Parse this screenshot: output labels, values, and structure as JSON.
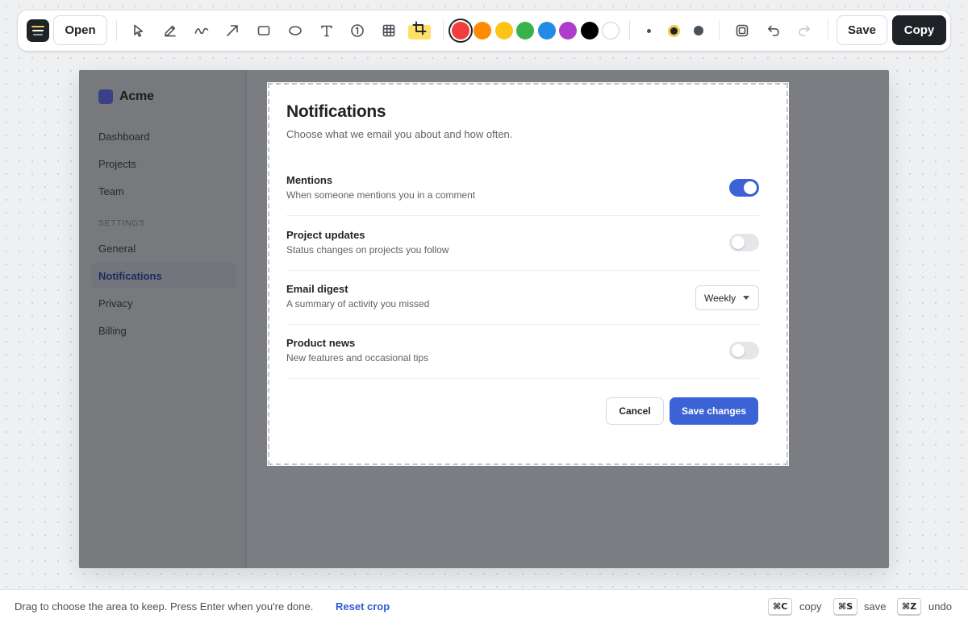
{
  "toolbar": {
    "open_label": "Open",
    "save_label": "Save",
    "copy_label": "Copy",
    "tools": [
      {
        "name": "select",
        "icon": "pointer-icon"
      },
      {
        "name": "pen",
        "icon": "pencil-icon"
      },
      {
        "name": "freehand",
        "icon": "squiggle-icon"
      },
      {
        "name": "arrow",
        "icon": "arrow-icon"
      },
      {
        "name": "rectangle",
        "icon": "rectangle-icon"
      },
      {
        "name": "ellipse",
        "icon": "ellipse-icon"
      },
      {
        "name": "text",
        "icon": "text-icon"
      },
      {
        "name": "counter",
        "icon": "numbered-circle-icon",
        "glyph": "1"
      },
      {
        "name": "grid",
        "icon": "grid-icon"
      },
      {
        "name": "crop",
        "icon": "crop-icon",
        "active": true
      }
    ],
    "colors": [
      "#f03e3e",
      "#fd8c00",
      "#fcc419",
      "#37b24d",
      "#228be6",
      "#ae3ec9",
      "#000000",
      "#ffffff"
    ],
    "selected_color": "#f03e3e",
    "stroke_sizes": [
      "small",
      "medium",
      "large"
    ],
    "selected_stroke": "medium"
  },
  "app": {
    "brand": "Acme",
    "brand_color": "#3b4189",
    "nav": [
      "Dashboard",
      "Projects",
      "Team"
    ],
    "settings_heading": "SETTINGS",
    "settings_nav": [
      "General",
      "Notifications",
      "Privacy",
      "Billing"
    ],
    "active_nav": "Notifications"
  },
  "panel": {
    "title": "Notifications",
    "subtitle": "Choose what we email you about and how often.",
    "rows": [
      {
        "label": "Mentions",
        "desc": "When someone mentions you in a comment",
        "control": "toggle",
        "on": true
      },
      {
        "label": "Project updates",
        "desc": "Status changes on projects you follow",
        "control": "toggle",
        "on": false
      },
      {
        "label": "Email digest",
        "desc": "A summary of activity you missed",
        "control": "select",
        "value": "Weekly"
      },
      {
        "label": "Product news",
        "desc": "New features and occasional tips",
        "control": "toggle",
        "on": false
      }
    ],
    "cancel_label": "Cancel",
    "submit_label": "Save changes",
    "accent": "#3b63d6"
  },
  "statusbar": {
    "hint": "Drag to choose the area to keep. Press Enter when you're done.",
    "reset_label": "Reset crop",
    "shortcuts": [
      {
        "key": "⌘C",
        "label": "copy"
      },
      {
        "key": "⌘S",
        "label": "save"
      },
      {
        "key": "⌘Z",
        "label": "undo"
      }
    ]
  }
}
